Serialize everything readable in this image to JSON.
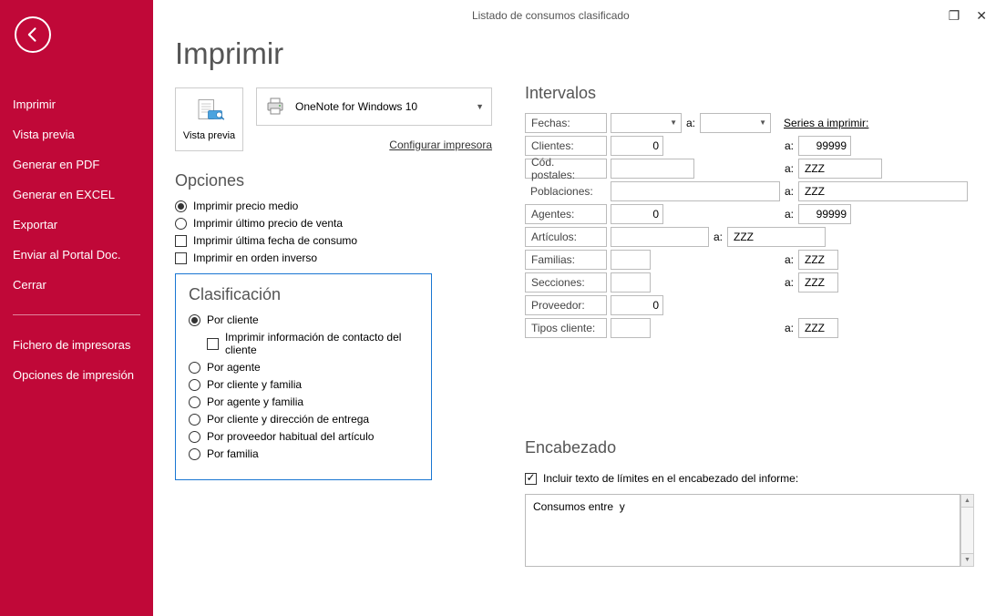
{
  "window_title": "Listado de consumos clasificado",
  "sidebar": {
    "items": [
      "Imprimir",
      "Vista previa",
      "Generar en PDF",
      "Generar en EXCEL",
      "Exportar",
      "Enviar al Portal Doc.",
      "Cerrar"
    ],
    "extra": [
      "Fichero de impresoras",
      "Opciones de impresión"
    ]
  },
  "page_heading": "Imprimir",
  "preview_label": "Vista previa",
  "printer_name": "OneNote for Windows 10",
  "config_printer": "Configurar impresora",
  "opciones_heading": "Opciones",
  "opciones": {
    "r_precio_medio": "Imprimir precio medio",
    "r_ultimo_precio": "Imprimir último precio de venta",
    "c_ultima_fecha": "Imprimir última fecha de consumo",
    "c_orden_inverso": "Imprimir en orden inverso"
  },
  "clasif_heading": "Clasificación",
  "clasif": {
    "por_cliente": "Por cliente",
    "contacto": "Imprimir información de contacto del cliente",
    "por_agente": "Por agente",
    "por_cliente_familia": "Por cliente y familia",
    "por_agente_familia": "Por agente y familia",
    "por_cliente_dir": "Por cliente y dirección de entrega",
    "por_proveedor": "Por proveedor habitual del artículo",
    "por_familia": "Por familia"
  },
  "int_heading": "Intervalos",
  "series_link": "Series a imprimir:",
  "a_label": "a:",
  "intervals": {
    "fechas": {
      "label": "Fechas:",
      "from": "",
      "to": ""
    },
    "clientes": {
      "label": "Clientes:",
      "from": "0",
      "to": "99999"
    },
    "codpost": {
      "label": "Cód. postales:",
      "from": "",
      "to": "ZZZ"
    },
    "pobl": {
      "label": "Poblaciones:",
      "from": "",
      "to": "ZZZ"
    },
    "agentes": {
      "label": "Agentes:",
      "from": "0",
      "to": "99999"
    },
    "articulos": {
      "label": "Artículos:",
      "from": "",
      "to": "ZZZ"
    },
    "familias": {
      "label": "Familias:",
      "from": "",
      "to": "ZZZ"
    },
    "secciones": {
      "label": "Secciones:",
      "from": "",
      "to": "ZZZ"
    },
    "proveedor": {
      "label": "Proveedor:",
      "from": "0",
      "to": ""
    },
    "tiposcli": {
      "label": "Tipos cliente:",
      "from": "",
      "to": "ZZZ"
    }
  },
  "enc_heading": "Encabezado",
  "enc_check": "Incluir texto de límites en el encabezado del informe:",
  "enc_text": "Consumos entre  y"
}
